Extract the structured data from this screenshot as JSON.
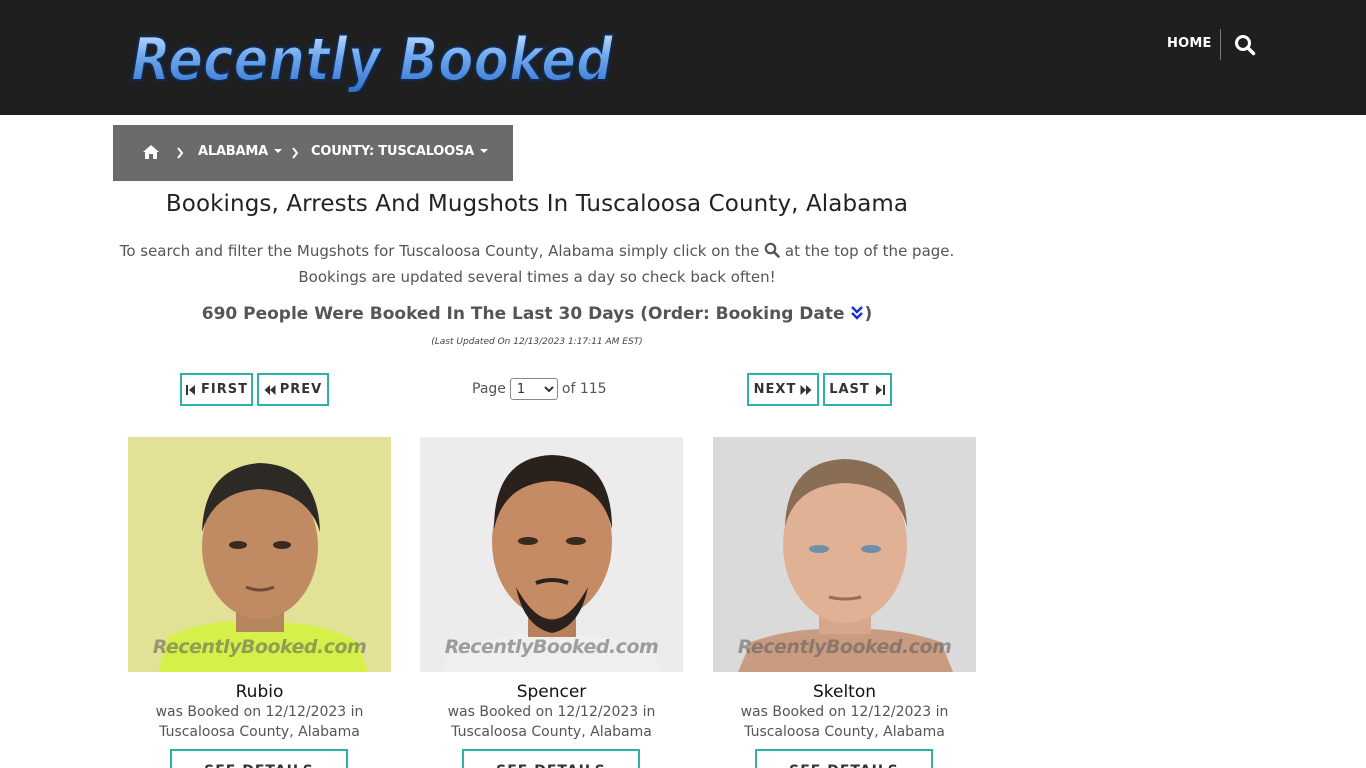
{
  "header": {
    "logo_text": "Recently Booked",
    "nav_home": "HOME",
    "search_icon": "search-icon"
  },
  "breadcrumb": {
    "home_icon": "home-icon",
    "state": "ALABAMA",
    "county": "COUNTY: TUSCALOOSA"
  },
  "main": {
    "title": "Bookings, Arrests And Mugshots In Tuscaloosa County, Alabama",
    "intro_part1": "To search and filter the Mugshots for Tuscaloosa County, Alabama simply click on the",
    "intro_part2": "at the top of the page.",
    "intro_line2": "Bookings are updated several times a day so check back often!",
    "count_text": "690 People Were Booked In The Last 30 Days (Order: Booking Date",
    "count_close": ")",
    "updated": "(Last Updated On 12/13/2023 1:17:11 AM EST)"
  },
  "pager": {
    "first": "FIRST",
    "prev": "PREV",
    "page_label": "Page",
    "current_page": "1",
    "of_label": "of 115",
    "next": "NEXT",
    "last": "LAST"
  },
  "cards": [
    {
      "name": "Rubio",
      "line1": "was Booked on 12/12/2023 in",
      "line2": "Tuscaloosa County, Alabama",
      "watermark": "RecentlyBooked.com",
      "button": "SEE DETAILS"
    },
    {
      "name": "Spencer",
      "line1": "was Booked on 12/12/2023 in",
      "line2": "Tuscaloosa County, Alabama",
      "watermark": "RecentlyBooked.com",
      "button": "SEE DETAILS"
    },
    {
      "name": "Skelton",
      "line1": "was Booked on 12/12/2023 in",
      "line2": "Tuscaloosa County, Alabama",
      "watermark": "RecentlyBooked.com",
      "button": "SEE DETAILS"
    }
  ],
  "colors": {
    "header_bg": "#1f1f1f",
    "breadcrumb_bg": "#6b6b6b",
    "button_border": "#2bb3a8",
    "logo_blue": "#4a8fe0"
  }
}
